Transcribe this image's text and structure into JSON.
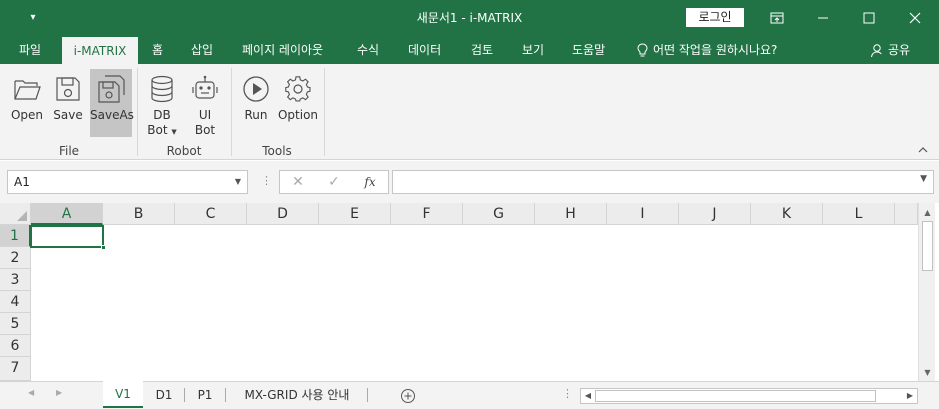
{
  "window": {
    "title": "새문서1  -  i-MATRIX",
    "login_label": "로그인"
  },
  "menu": {
    "tabs": [
      {
        "label": "파일"
      },
      {
        "label": "i-MATRIX"
      },
      {
        "label": "홈"
      },
      {
        "label": "삽입"
      },
      {
        "label": "페이지 레이아웃"
      },
      {
        "label": "수식"
      },
      {
        "label": "데이터"
      },
      {
        "label": "검토"
      },
      {
        "label": "보기"
      },
      {
        "label": "도움말"
      }
    ],
    "search_label": "어떤 작업을 원하시나요?",
    "share_label": "공유",
    "active_tab": "i-MATRIX"
  },
  "ribbon": {
    "groups": [
      {
        "label": "File"
      },
      {
        "label": "Robot"
      },
      {
        "label": "Tools"
      }
    ],
    "buttons": {
      "open": {
        "label": "Open",
        "icon": "folder-open-icon"
      },
      "save": {
        "label": "Save",
        "icon": "save-icon"
      },
      "saveas": {
        "label": "SaveAs",
        "icon": "save-as-icon"
      },
      "dbbot": {
        "line1": "DB",
        "line2": "Bot",
        "icon": "database-icon"
      },
      "uibot": {
        "line1": "UI",
        "line2": "Bot",
        "icon": "robot-icon"
      },
      "run": {
        "label": "Run",
        "icon": "play-icon"
      },
      "option": {
        "label": "Option",
        "icon": "gear-icon"
      }
    }
  },
  "formula_bar": {
    "name_box": "A1",
    "fx_label": "fx",
    "formula": ""
  },
  "grid": {
    "columns": [
      "A",
      "B",
      "C",
      "D",
      "E",
      "F",
      "G",
      "H",
      "I",
      "J",
      "K",
      "L"
    ],
    "rows": [
      "1",
      "2",
      "3",
      "4",
      "5",
      "6",
      "7"
    ],
    "selected_cell": "A1"
  },
  "sheets": {
    "tabs": [
      {
        "label": "V1"
      },
      {
        "label": "D1"
      },
      {
        "label": "P1"
      },
      {
        "label": "MX-GRID 사용 안내"
      }
    ],
    "active": "V1"
  },
  "colors": {
    "accent": "#217346",
    "ribbon_bg": "#f3f3f3",
    "selected_button": "#c5c5c5"
  }
}
